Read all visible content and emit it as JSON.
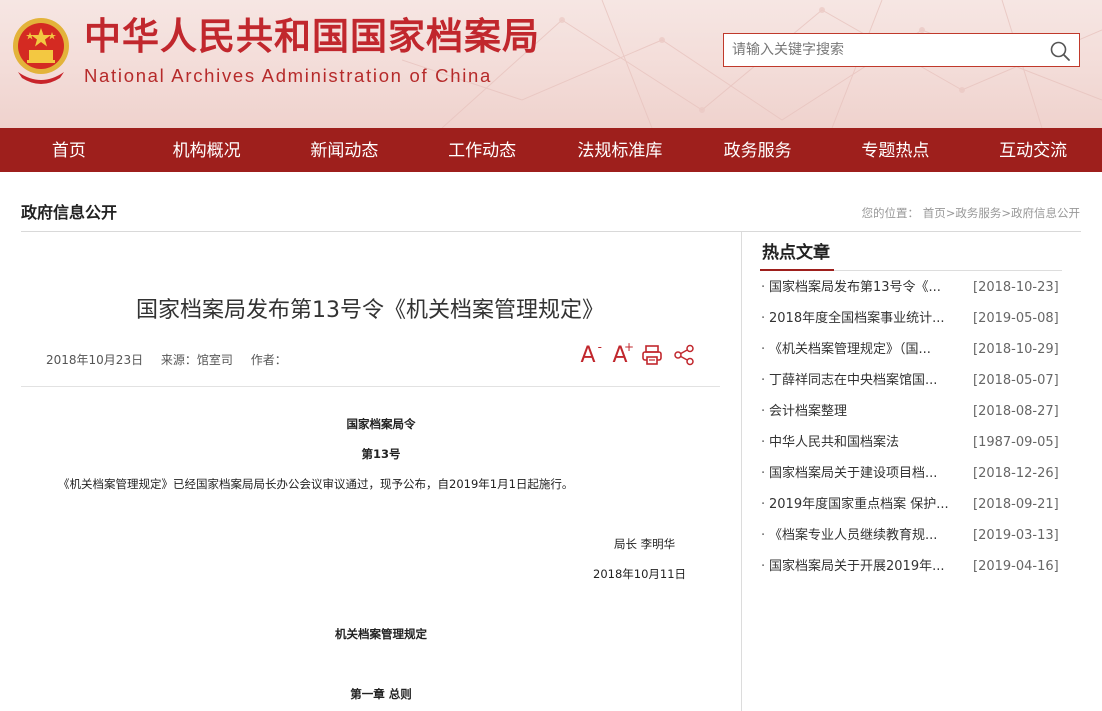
{
  "header": {
    "title_cn": "中华人民共和国国家档案局",
    "title_en": "National Archives Administration of China",
    "search": {
      "placeholder": "请输入关键字搜索",
      "value": ""
    }
  },
  "nav": [
    {
      "label": "首页"
    },
    {
      "label": "机构概况"
    },
    {
      "label": "新闻动态"
    },
    {
      "label": "工作动态"
    },
    {
      "label": "法规标准库"
    },
    {
      "label": "政务服务"
    },
    {
      "label": "专题热点"
    },
    {
      "label": "互动交流"
    }
  ],
  "page": {
    "section_title": "政府信息公开",
    "breadcrumb": {
      "prefix": "您的位置：",
      "items": [
        "首页",
        "政务服务",
        "政府信息公开"
      ],
      "separator": ">"
    }
  },
  "article": {
    "title": "国家档案局发布第13号令《机关档案管理规定》",
    "date": "2018年10月23日",
    "source_label": "来源：馆室司",
    "author_label": "作者：",
    "tools": {
      "font_decrease": "A",
      "font_increase": "A",
      "minus_sign": "-",
      "plus_sign": "+"
    },
    "body": {
      "order_heading": "国家档案局令",
      "order_number": "第13号",
      "paragraph": "《机关档案管理规定》已经国家档案局局长办公会议审议通过，现予公布，自2019年1月1日起施行。",
      "signature": "局长 李明华",
      "sign_date": "2018年10月11日",
      "regulation_title": "机关档案管理规定",
      "chapter_one": "第一章 总则"
    }
  },
  "hot": {
    "title": "热点文章",
    "items": [
      {
        "text": "国家档案局发布第13号令《...",
        "date": "[2018-10-23]"
      },
      {
        "text": "2018年度全国档案事业统计...",
        "date": "[2019-05-08]"
      },
      {
        "text": "《机关档案管理规定》（国...",
        "date": "[2018-10-29]"
      },
      {
        "text": "丁薛祥同志在中央档案馆国...",
        "date": "[2018-05-07]"
      },
      {
        "text": "会计档案整理",
        "date": "[2018-08-27]"
      },
      {
        "text": "中华人民共和国档案法",
        "date": "[1987-09-05]"
      },
      {
        "text": "国家档案局关于建设项目档...",
        "date": "[2018-12-26]"
      },
      {
        "text": "2019年度国家重点档案 保护...",
        "date": "[2018-09-21]"
      },
      {
        "text": "《档案专业人员继续教育规...",
        "date": "[2019-03-13]"
      },
      {
        "text": "国家档案局关于开展2019年...",
        "date": "[2019-04-16]"
      }
    ]
  },
  "colors": {
    "brand_red": "#c1272d",
    "nav_red": "#9e1f1c"
  }
}
